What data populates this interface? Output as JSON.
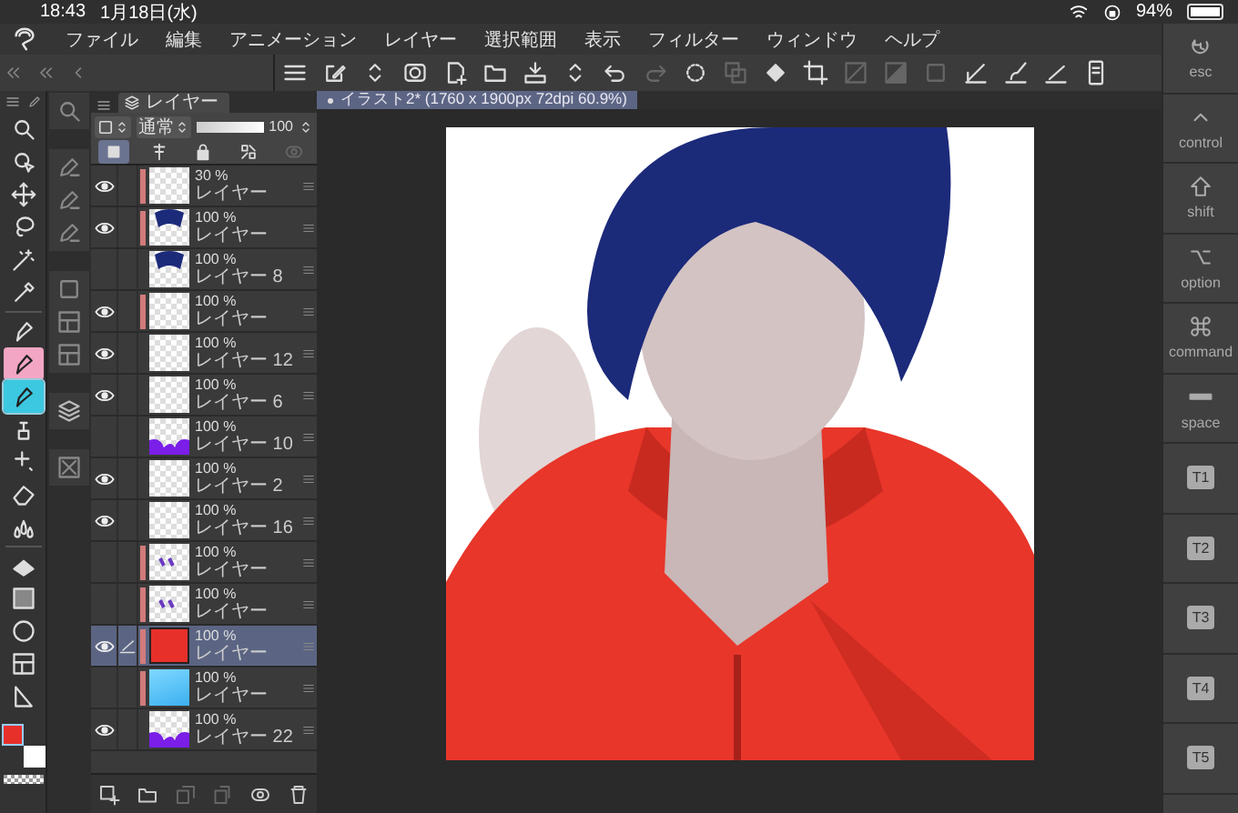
{
  "status_bar": {
    "time": "18:43",
    "date": "1月18日(水)",
    "battery": "94%"
  },
  "menu": [
    "ファイル",
    "編集",
    "アニメーション",
    "レイヤー",
    "選択範囲",
    "表示",
    "フィルター",
    "ウィンドウ",
    "ヘルプ"
  ],
  "toolbar": [
    {
      "kind": "menu",
      "disabled": false
    },
    {
      "kind": "pencil-square",
      "disabled": false
    },
    {
      "kind": "updown",
      "disabled": false
    },
    {
      "kind": "canvas",
      "disabled": false
    },
    {
      "kind": "new-file",
      "disabled": false
    },
    {
      "kind": "folder",
      "disabled": false
    },
    {
      "kind": "tray",
      "disabled": false
    },
    {
      "kind": "updown",
      "disabled": false
    },
    {
      "kind": "undo",
      "disabled": false
    },
    {
      "kind": "redo",
      "disabled": true
    },
    {
      "kind": "dotted-circle",
      "disabled": false
    },
    {
      "kind": "squares",
      "disabled": true
    },
    {
      "kind": "bucket",
      "disabled": false
    },
    {
      "kind": "crop",
      "disabled": false
    },
    {
      "kind": "square-slash",
      "disabled": true
    },
    {
      "kind": "square-gradient",
      "disabled": true
    },
    {
      "kind": "square",
      "disabled": true
    },
    {
      "kind": "ruler-pen",
      "disabled": false
    },
    {
      "kind": "brush",
      "disabled": false
    },
    {
      "kind": "pen-line",
      "disabled": false
    },
    {
      "kind": "tablet",
      "disabled": false
    }
  ],
  "tools": [
    {
      "kind": "zoom",
      "selected": false
    },
    {
      "kind": "select",
      "selected": false
    },
    {
      "kind": "move",
      "selected": false
    },
    {
      "kind": "lasso",
      "selected": false
    },
    {
      "kind": "wand",
      "selected": false
    },
    {
      "kind": "eyedropper",
      "selected": false
    },
    {
      "kind": "pen",
      "selected": false
    },
    {
      "kind": "pen",
      "selected": false,
      "color": "#f2a6c4"
    },
    {
      "kind": "pen",
      "selected": true,
      "color": "#3cc8e0"
    },
    {
      "kind": "airbrush",
      "selected": false
    },
    {
      "kind": "deco",
      "selected": false
    },
    {
      "kind": "eraser",
      "selected": false
    },
    {
      "kind": "blend",
      "selected": false
    },
    {
      "kind": "fill",
      "selected": false
    },
    {
      "kind": "gradient",
      "selected": false
    },
    {
      "kind": "figure",
      "selected": false
    },
    {
      "kind": "frame",
      "selected": false
    },
    {
      "kind": "ruler",
      "selected": false
    }
  ],
  "color_swatches": [
    {
      "color": "#e8302a"
    },
    {
      "color": "#ffffff"
    }
  ],
  "layer_panel": {
    "title": "レイヤー",
    "blend_mode": "通常",
    "opacity_slider": {
      "level": 1
    },
    "opacity": "100",
    "layer_tools": [
      {
        "kind": "clip",
        "on": true,
        "disabled": false
      },
      {
        "kind": "ref",
        "on": false,
        "disabled": false
      },
      {
        "kind": "lock",
        "on": false,
        "disabled": false
      },
      {
        "kind": "alpha-lock",
        "on": false,
        "disabled": false
      },
      {
        "kind": "mask",
        "on": false,
        "disabled": true
      }
    ],
    "layers": [
      {
        "opacity": "30 %",
        "name": "レイヤー",
        "visible": true,
        "clipped": true,
        "selected": false,
        "kind": "blank"
      },
      {
        "opacity": "100 %",
        "name": "レイヤー",
        "visible": true,
        "clipped": true,
        "selected": false,
        "kind": "hair"
      },
      {
        "opacity": "100 %",
        "name": "レイヤー 8",
        "visible": false,
        "clipped": false,
        "selected": false,
        "kind": "hair"
      },
      {
        "opacity": "100 %",
        "name": "レイヤー",
        "visible": true,
        "clipped": true,
        "selected": false,
        "kind": "blank"
      },
      {
        "opacity": "100 %",
        "name": "レイヤー 12",
        "visible": true,
        "clipped": false,
        "selected": false,
        "kind": "blank"
      },
      {
        "opacity": "100 %",
        "name": "レイヤー 6",
        "visible": true,
        "clipped": false,
        "selected": false,
        "kind": "blank"
      },
      {
        "opacity": "100 %",
        "name": "レイヤー 10",
        "visible": false,
        "clipped": false,
        "selected": false,
        "kind": "purple"
      },
      {
        "opacity": "100 %",
        "name": "レイヤー 2",
        "visible": true,
        "clipped": false,
        "selected": false,
        "kind": "blank"
      },
      {
        "opacity": "100 %",
        "name": "レイヤー 16",
        "visible": true,
        "clipped": false,
        "selected": false,
        "kind": "blank"
      },
      {
        "opacity": "100 %",
        "name": "レイヤー",
        "visible": false,
        "clipped": true,
        "selected": false,
        "kind": "marks"
      },
      {
        "opacity": "100 %",
        "name": "レイヤー",
        "visible": false,
        "clipped": true,
        "selected": false,
        "kind": "marks"
      },
      {
        "opacity": "100 %",
        "name": "レイヤー",
        "visible": true,
        "clipped": true,
        "selected": true,
        "kind": "red"
      },
      {
        "opacity": "100 %",
        "name": "レイヤー",
        "visible": false,
        "clipped": true,
        "selected": false,
        "kind": "blue"
      },
      {
        "opacity": "100 %",
        "name": "レイヤー 22",
        "visible": true,
        "clipped": false,
        "selected": false,
        "kind": "purple"
      }
    ],
    "bottom_tools": [
      {
        "kind": "new-layer",
        "disabled": false
      },
      {
        "kind": "folder",
        "disabled": false
      },
      {
        "kind": "copy",
        "disabled": true
      },
      {
        "kind": "merge",
        "disabled": true
      },
      {
        "kind": "mask",
        "disabled": false
      },
      {
        "kind": "trash",
        "disabled": false
      }
    ]
  },
  "document_tab": {
    "label": "イラスト2* (1760 x 1900px 72dpi 60.9%)",
    "selected": true
  },
  "keys": [
    {
      "kind": "esc",
      "label": "esc"
    },
    {
      "kind": "control",
      "label": "control"
    },
    {
      "kind": "shift",
      "label": "shift"
    },
    {
      "kind": "option",
      "label": "option"
    },
    {
      "kind": "command",
      "label": "command"
    },
    {
      "kind": "space",
      "label": "space"
    },
    {
      "kind": "tile",
      "label": "T1"
    },
    {
      "kind": "tile",
      "label": "T2"
    },
    {
      "kind": "tile",
      "label": "T3"
    },
    {
      "kind": "tile",
      "label": "T4"
    },
    {
      "kind": "tile",
      "label": "T5"
    }
  ]
}
